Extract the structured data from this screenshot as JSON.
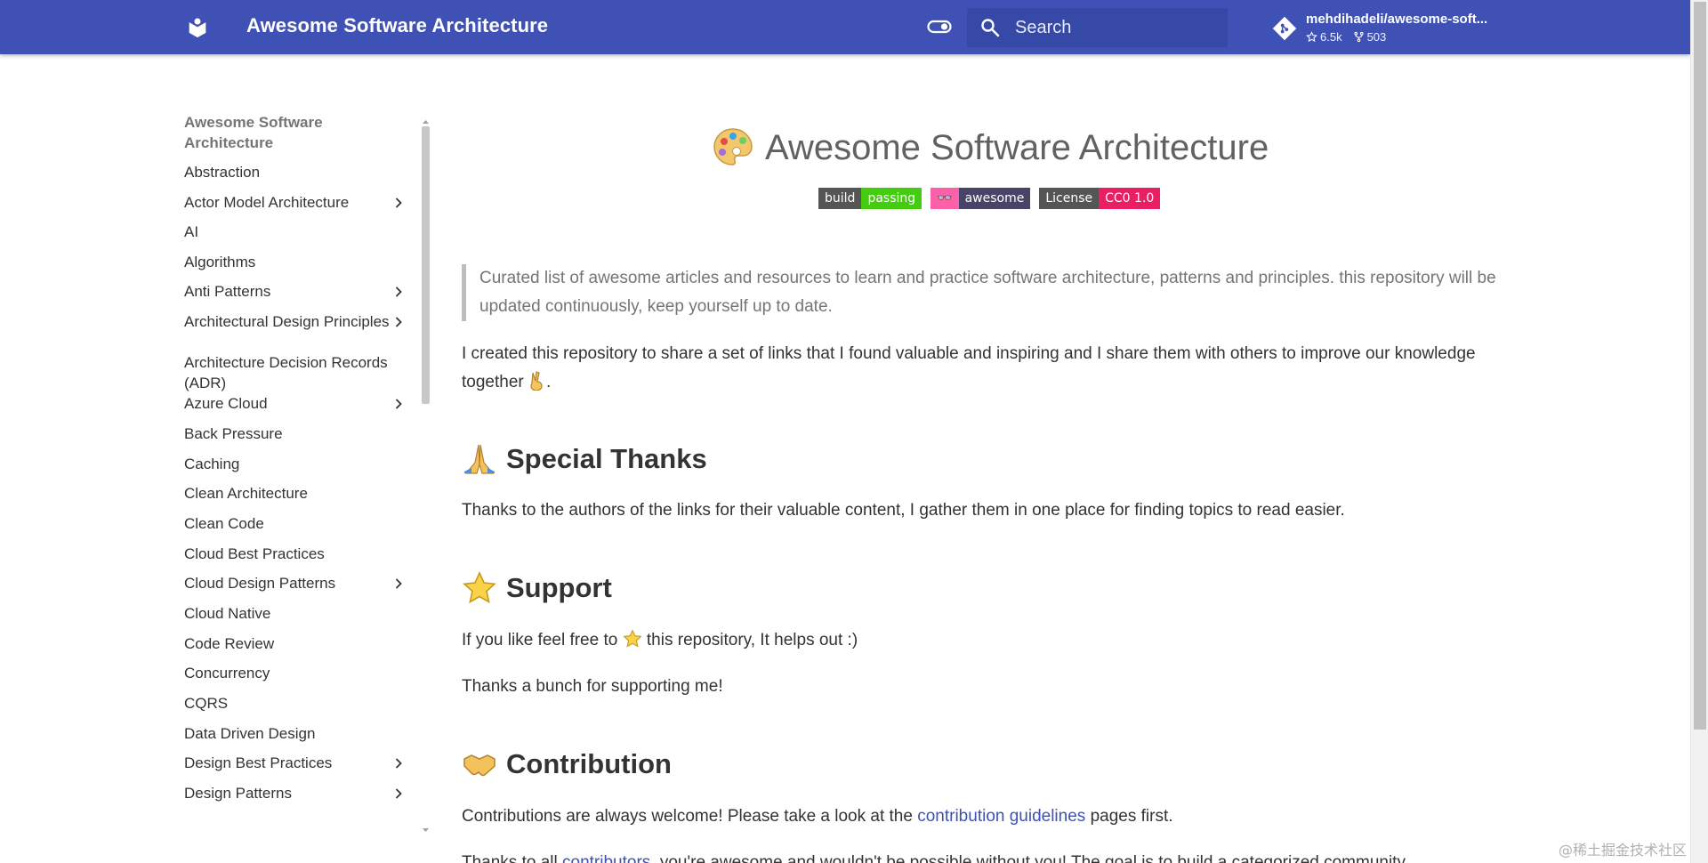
{
  "header": {
    "site_title": "Awesome Software Architecture",
    "search_placeholder": "Search",
    "repo_name": "mehdihadeli/awesome-soft...",
    "stars": "6.5k",
    "forks": "503",
    "icons": [
      "book-icon",
      "toggle-icon",
      "search-icon",
      "git-icon",
      "star-icon",
      "fork-icon"
    ],
    "colors": {
      "bar": "#3f51b5",
      "search_bg": "#3749a6"
    }
  },
  "sidebar": {
    "items": [
      {
        "label": "Awesome Software Architecture",
        "active": true,
        "expandable": false
      },
      {
        "label": "Abstraction",
        "expandable": false
      },
      {
        "label": "Actor Model Architecture",
        "expandable": true
      },
      {
        "label": "AI",
        "expandable": false
      },
      {
        "label": "Algorithms",
        "expandable": false
      },
      {
        "label": "Anti Patterns",
        "expandable": true
      },
      {
        "label": "Architectural Design Principles",
        "expandable": true
      },
      {
        "label": "Architecture Decision Records (ADR)",
        "expandable": false
      },
      {
        "label": "Azure Cloud",
        "expandable": true
      },
      {
        "label": "Back Pressure",
        "expandable": false
      },
      {
        "label": "Caching",
        "expandable": false
      },
      {
        "label": "Clean Architecture",
        "expandable": false
      },
      {
        "label": "Clean Code",
        "expandable": false
      },
      {
        "label": "Cloud Best Practices",
        "expandable": false
      },
      {
        "label": "Cloud Design Patterns",
        "expandable": true
      },
      {
        "label": "Cloud Native",
        "expandable": false
      },
      {
        "label": "Code Review",
        "expandable": false
      },
      {
        "label": "Concurrency",
        "expandable": false
      },
      {
        "label": "CQRS",
        "expandable": false
      },
      {
        "label": "Data Driven Design",
        "expandable": false
      },
      {
        "label": "Design Best Practices",
        "expandable": true
      },
      {
        "label": "Design Patterns",
        "expandable": true
      }
    ]
  },
  "main": {
    "title": "Awesome Software Architecture",
    "badges": [
      {
        "left": "build",
        "right": "passing",
        "right_color": "#44cc11"
      },
      {
        "left": "👓",
        "right": "awesome",
        "right_color": "#494368"
      },
      {
        "left": "License",
        "right": "CC0 1.0",
        "right_color": "#e91e63"
      }
    ],
    "quote": "Curated list of awesome articles and resources to learn and practice software architecture, patterns and principles. this repository will be updated continuously, keep yourself up to date.",
    "intro": "I created this repository to share a set of links that I found valuable and inspiring and I share them with others to improve our knowledge together",
    "intro_end": ".",
    "special_thanks_heading": "Special Thanks",
    "special_thanks_text": "Thanks to the authors of the links for their valuable content, I gather them in one place for finding topics to read easier.",
    "support_heading": "Support",
    "support_text_before": "If you like feel free to",
    "support_text_after": "this repository, It helps out :)",
    "support_thanks": "Thanks a bunch for supporting me!",
    "contribution_heading": "Contribution",
    "contribution_before": "Contributions are always welcome! Please take a look at the",
    "contribution_link": "contribution guidelines",
    "contribution_after": "pages first.",
    "contributors_before": "Thanks to all",
    "contributors_link": "contributors",
    "contributors_after": ", you're awesome and wouldn't be possible without you! The goal is to build a categorized community"
  },
  "watermark": "@稀土掘金技术社区"
}
